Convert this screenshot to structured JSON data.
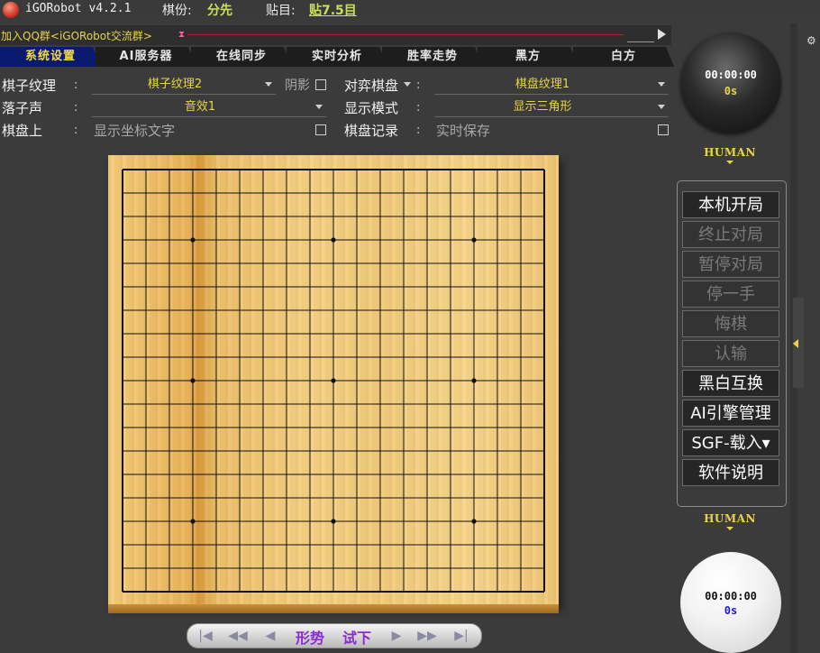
{
  "titlebar": {
    "app_name": "iGORobot v4.2.1",
    "handicap_label": "棋份:",
    "handicap_value": "分先",
    "komi_label": "贴目:",
    "komi_value": "贴7.5目"
  },
  "linkbar": {
    "qq_link": "加入QQ群<iGORobot交流群>"
  },
  "tabs": [
    {
      "label": "系统设置",
      "active": true
    },
    {
      "label": "AI服务器",
      "active": false
    },
    {
      "label": "在线同步",
      "active": false
    },
    {
      "label": "实时分析",
      "active": false
    },
    {
      "label": "胜率走势",
      "active": false
    },
    {
      "label": "黑方",
      "active": false
    },
    {
      "label": "白方",
      "active": false
    }
  ],
  "settings": {
    "stone_texture": {
      "label": "棋子纹理",
      "value": "棋子纹理2"
    },
    "shadow": {
      "label": "阴影"
    },
    "board_select": {
      "label": "对弈棋盘"
    },
    "board_texture": {
      "value": "棋盘纹理1"
    },
    "stone_sound": {
      "label": "落子声",
      "value": "音效1"
    },
    "display_mode": {
      "label": "显示模式",
      "value": "显示三角形"
    },
    "on_board": {
      "label": "棋盘上",
      "value": "显示坐标文字"
    },
    "board_record": {
      "label": "棋盘记录",
      "value": "实时保存"
    },
    "colon": ":"
  },
  "board": {
    "size": 19,
    "star_points": [
      [
        3,
        3
      ],
      [
        3,
        9
      ],
      [
        3,
        15
      ],
      [
        9,
        3
      ],
      [
        9,
        9
      ],
      [
        9,
        15
      ],
      [
        15,
        3
      ],
      [
        15,
        9
      ],
      [
        15,
        15
      ]
    ]
  },
  "navbar": {
    "first": "|◀",
    "prev5": "◀◀",
    "prev": "◀",
    "territory": "形势",
    "trial": "试下",
    "next": "▶",
    "next5": "▶▶",
    "last": "▶|"
  },
  "players": {
    "black": {
      "time": "00:00:00",
      "seconds": "0s",
      "type": "HUMAN"
    },
    "white": {
      "time": "00:00:00",
      "seconds": "0s",
      "type": "HUMAN"
    }
  },
  "buttons": [
    {
      "label": "本机开局",
      "enabled": true
    },
    {
      "label": "终止对局",
      "enabled": false
    },
    {
      "label": "暂停对局",
      "enabled": false
    },
    {
      "label": "停一手",
      "enabled": false
    },
    {
      "label": "悔棋",
      "enabled": false
    },
    {
      "label": "认输",
      "enabled": false
    },
    {
      "label": "黑白互换",
      "enabled": true
    },
    {
      "label": "AI引擎管理",
      "enabled": true
    },
    {
      "label": "SGF-载入▾",
      "enabled": true
    },
    {
      "label": "软件说明",
      "enabled": true
    }
  ],
  "colors": {
    "accent_yellow": "#e8d44a",
    "active_tab": "#0a1a6e",
    "handicap_green": "#c8e05a",
    "secondary_blue": "#1a1ad0"
  }
}
